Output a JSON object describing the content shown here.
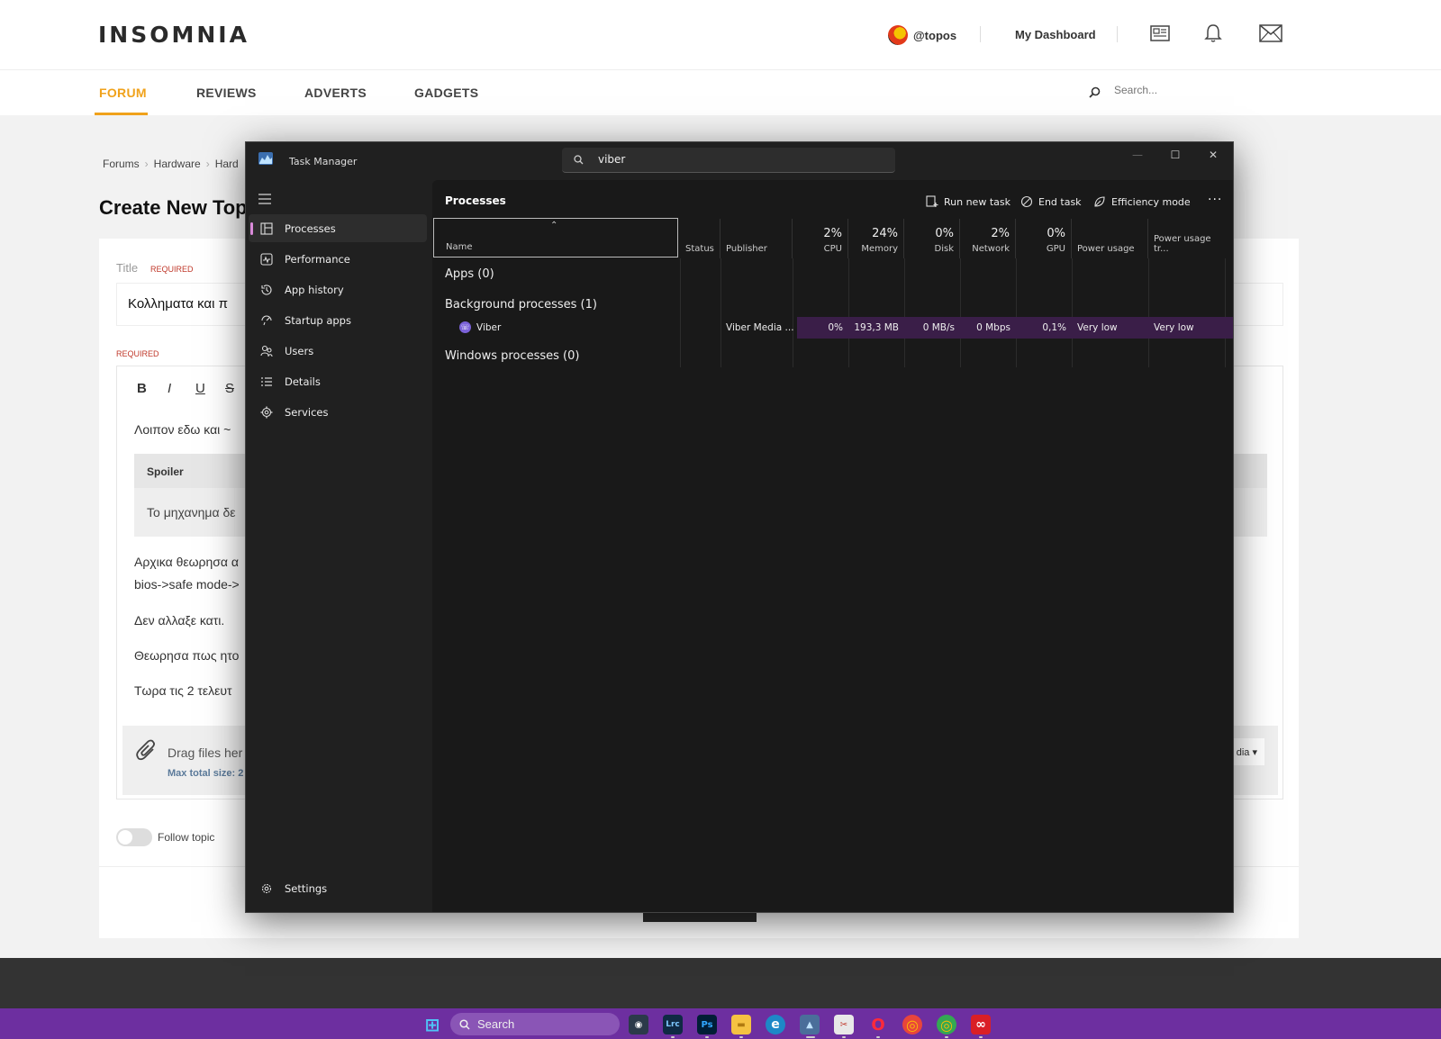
{
  "site": {
    "logo": "INSOMNIA",
    "username": "@topos",
    "dashboard_label": "My Dashboard",
    "nav": [
      {
        "label": "FORUM",
        "active": true
      },
      {
        "label": "REVIEWS",
        "active": false
      },
      {
        "label": "ADVERTS",
        "active": false
      },
      {
        "label": "GADGETS",
        "active": false
      }
    ],
    "search_placeholder": "Search...",
    "breadcrumbs": [
      "Forums",
      "Hardware",
      "Hard"
    ],
    "page_title": "Create New Top",
    "title_label": "Title",
    "required_label": "REQUIRED",
    "title_value": "Κολληματα και π",
    "toolbar": {
      "bold": "B",
      "italic": "I",
      "underline": "U",
      "strike": "S"
    },
    "editor_lines": {
      "l1": "Λοιπον εδω και ~",
      "l3": "Αρχικα θεωρησα α",
      "l4": "bios->safe mode->",
      "l5": "Δεν αλλαξε κατι.",
      "l6": "Θεωρησα πως ητο",
      "l7": "Τωρα τις 2 τελευτ"
    },
    "spoiler_label": "Spoiler",
    "spoiler_text": "Το μηχανημα δε",
    "drag_text": "Drag files her",
    "max_size_text": "Max total size: 2",
    "media_button": "dia ▾",
    "follow_label": "Follow topic",
    "accent_color": "#f0a21b"
  },
  "task_manager": {
    "window_title": "Task Manager",
    "search_value": "viber",
    "window_controls": {
      "minimize": "—",
      "maximize": "☐",
      "close": "✕"
    },
    "sidebar": [
      {
        "label": "Processes",
        "icon": "processes-icon",
        "active": true
      },
      {
        "label": "Performance",
        "icon": "performance-icon"
      },
      {
        "label": "App history",
        "icon": "history-icon"
      },
      {
        "label": "Startup apps",
        "icon": "startup-icon"
      },
      {
        "label": "Users",
        "icon": "users-icon"
      },
      {
        "label": "Details",
        "icon": "details-icon"
      },
      {
        "label": "Services",
        "icon": "services-icon"
      }
    ],
    "settings_label": "Settings",
    "section_title": "Processes",
    "toolbar": {
      "run_new_task": "Run new task",
      "end_task": "End task",
      "efficiency_mode": "Efficiency mode",
      "more": "···"
    },
    "columns": {
      "name": "Name",
      "status": "Status",
      "publisher": "Publisher",
      "cpu": {
        "pct": "2%",
        "label": "CPU"
      },
      "memory": {
        "pct": "24%",
        "label": "Memory"
      },
      "disk": {
        "pct": "0%",
        "label": "Disk"
      },
      "network": {
        "pct": "2%",
        "label": "Network"
      },
      "gpu": {
        "pct": "0%",
        "label": "GPU"
      },
      "power": "Power usage",
      "power_trend": "Power usage tr..."
    },
    "groups": {
      "apps": "Apps (0)",
      "background": "Background processes (1)",
      "windows": "Windows processes (0)"
    },
    "process": {
      "name": "Viber",
      "publisher": "Viber Media ...",
      "cpu": "0%",
      "memory": "193,3 MB",
      "disk": "0 MB/s",
      "network": "0 Mbps",
      "gpu": "0,1%",
      "power": "Very low",
      "power_trend": "Very low"
    },
    "highlight_color": "#3a1e48"
  },
  "taskbar": {
    "search_label": "Search",
    "apps": [
      {
        "icon": "start-icon",
        "glyph": "⊞"
      },
      {
        "icon": "davinci-icon",
        "glyph": "◉"
      },
      {
        "icon": "lightroom-icon",
        "glyph": "Lrc"
      },
      {
        "icon": "photoshop-icon",
        "glyph": "Ps"
      },
      {
        "icon": "explorer-icon",
        "glyph": "▬"
      },
      {
        "icon": "edge-icon",
        "glyph": "e"
      },
      {
        "icon": "taskmanager-icon",
        "glyph": "▲"
      },
      {
        "icon": "snipping-icon",
        "glyph": "✂"
      },
      {
        "icon": "opera-icon",
        "glyph": "O"
      },
      {
        "icon": "chrome-icon",
        "glyph": "◎"
      },
      {
        "icon": "chrome-profile-icon",
        "glyph": "◎"
      },
      {
        "icon": "creative-cloud-icon",
        "glyph": "∞"
      }
    ]
  }
}
